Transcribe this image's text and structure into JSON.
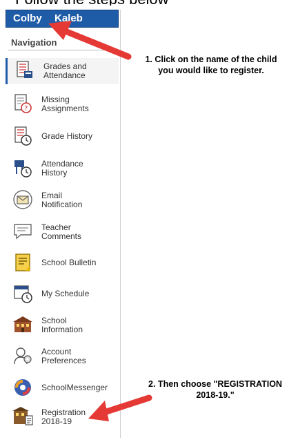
{
  "student": {
    "first_name": "Colby",
    "last_name": "Kaleb"
  },
  "navigation": {
    "title": "Navigation",
    "items": [
      {
        "l1": "Grades and",
        "l2": "Attendance",
        "icon": "grades-icon"
      },
      {
        "l1": "Missing",
        "l2": "Assignments",
        "icon": "missing-assignments-icon"
      },
      {
        "l1": "Grade History",
        "l2": "",
        "icon": "grade-history-icon"
      },
      {
        "l1": "Attendance",
        "l2": "History",
        "icon": "attendance-history-icon"
      },
      {
        "l1": "Email",
        "l2": "Notification",
        "icon": "email-icon"
      },
      {
        "l1": "Teacher",
        "l2": "Comments",
        "icon": "comments-icon"
      },
      {
        "l1": "School Bulletin",
        "l2": "",
        "icon": "bulletin-icon"
      },
      {
        "l1": "My Schedule",
        "l2": "",
        "icon": "schedule-icon"
      },
      {
        "l1": "School",
        "l2": "Information",
        "icon": "school-icon"
      },
      {
        "l1": "Account",
        "l2": "Preferences",
        "icon": "account-icon"
      },
      {
        "l1": "SchoolMessenger",
        "l2": "",
        "icon": "messenger-icon"
      },
      {
        "l1": "Registration",
        "l2": "2018-19",
        "icon": "registration-icon"
      }
    ]
  },
  "callouts": {
    "step1_line1": "1. Click on the name of the child",
    "step1_line2": "you would like to register.",
    "step2_line1": "2. Then choose \"REGISTRATION",
    "step2_line2": "2018-19.\""
  },
  "colors": {
    "student_bar": "#1f5ca8",
    "arrow": "#e53935",
    "active_border": "#1f5ca8"
  }
}
